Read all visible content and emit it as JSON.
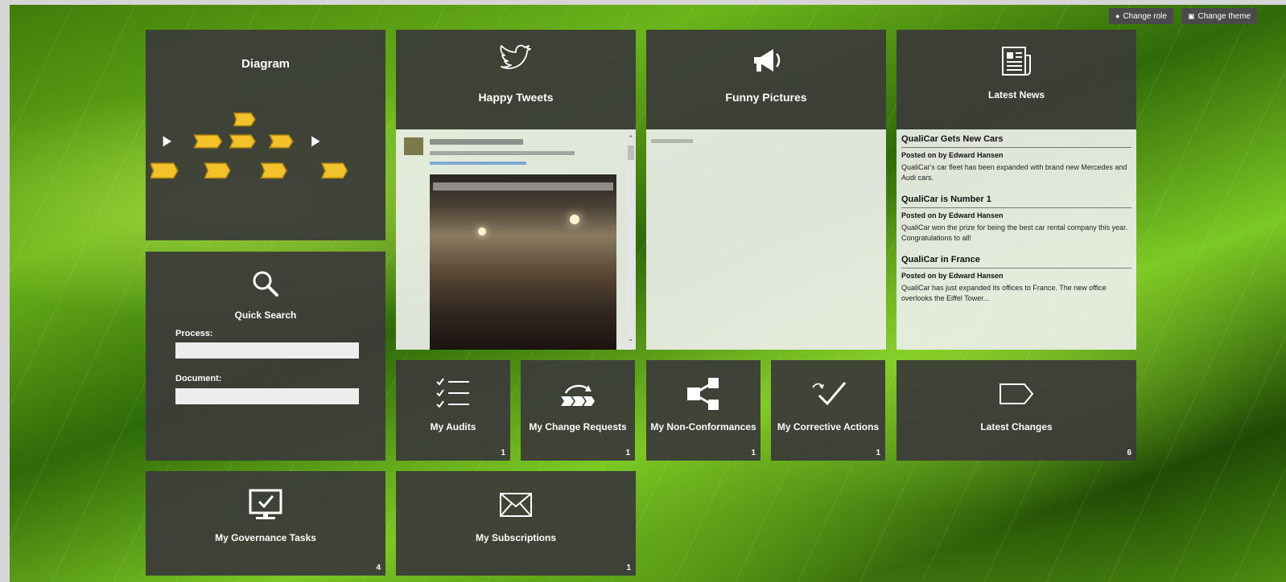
{
  "top_bar": {
    "change_role_label": "Change role",
    "change_theme_label": "Change theme"
  },
  "diagram": {
    "title": "Diagram"
  },
  "quick_search": {
    "title": "Quick Search",
    "process_label": "Process:",
    "process_value": "",
    "document_label": "Document:",
    "document_value": ""
  },
  "happy_tweets": {
    "title": "Happy Tweets"
  },
  "funny_pictures": {
    "title": "Funny Pictures"
  },
  "latest_news": {
    "title": "Latest News",
    "items": [
      {
        "title": "QualiCar Gets New Cars",
        "meta": "Posted on by Edward Hansen",
        "body": "QualiCar's car fleet has been expanded with brand new Mercedes and Audi cars."
      },
      {
        "title": "QualiCar is Number 1",
        "meta": "Posted on by Edward Hansen",
        "body": "QualiCar won the prize for being the best car rental company this year. Congratulations to all!"
      },
      {
        "title": "QualiCar in France",
        "meta": "Posted on by Edward Hansen",
        "body": "QualiCar has just expanded its offices to France. The new office overlooks the Eiffel Tower..."
      }
    ]
  },
  "tiles": {
    "my_audits": {
      "label": "My Audits",
      "count": "1",
      "icon": "checklist-icon"
    },
    "my_change_requests": {
      "label": "My Change Requests",
      "count": "1",
      "icon": "process-arrow-icon"
    },
    "my_non_conformances": {
      "label": "My Non-Conformances",
      "count": "1",
      "icon": "share-nodes-icon"
    },
    "my_corrective_actions": {
      "label": "My Corrective Actions",
      "count": "1",
      "icon": "checkmark-icon"
    },
    "latest_changes": {
      "label": "Latest Changes",
      "count": "6",
      "icon": "tag-icon"
    },
    "my_governance_tasks": {
      "label": "My Governance Tasks",
      "count": "4",
      "icon": "monitor-check-icon"
    },
    "my_subscriptions": {
      "label": "My Subscriptions",
      "count": "1",
      "icon": "envelope-icon"
    }
  },
  "colors": {
    "tile_bg": "#3c3c38",
    "panel_bg": "#ebeee8",
    "chevron": "#f3c12a",
    "background": "#5aa815"
  }
}
